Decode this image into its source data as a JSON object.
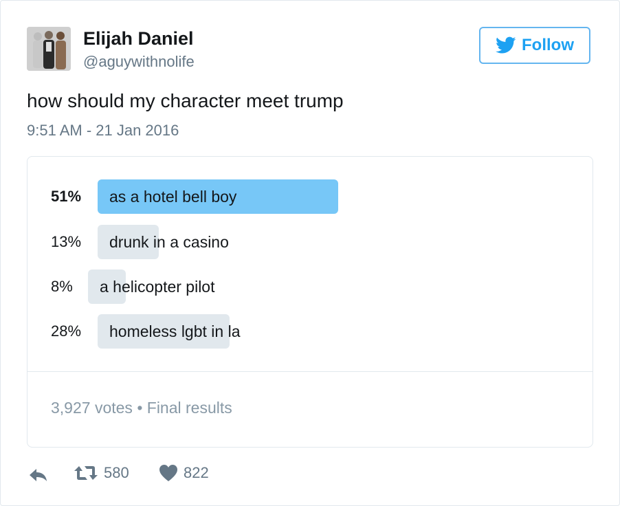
{
  "user": {
    "name": "Elijah Daniel",
    "handle": "@aguywithnolife",
    "follow_label": "Follow"
  },
  "tweet": {
    "text": "how should my character meet trump",
    "timestamp": "9:51 AM - 21 Jan 2016"
  },
  "poll": {
    "choices": [
      {
        "percent": "51%",
        "label": "as a hotel bell boy",
        "value": 51,
        "winner": true
      },
      {
        "percent": "13%",
        "label": "drunk in a casino",
        "value": 13,
        "winner": false
      },
      {
        "percent": "8%",
        "label": "a helicopter pilot",
        "value": 8,
        "winner": false
      },
      {
        "percent": "28%",
        "label": "homeless lgbt in la",
        "value": 28,
        "winner": false
      }
    ],
    "votes": "3,927 votes",
    "separator": "•",
    "status": "Final results"
  },
  "stats": {
    "retweets": "580",
    "likes": "822"
  },
  "colors": {
    "accent": "#1da1f2",
    "winner_bar": "#77c7f7",
    "bar": "#e1e8ed"
  },
  "icons": [
    "twitter-bird-icon",
    "reply-icon",
    "retweet-icon",
    "heart-icon"
  ]
}
